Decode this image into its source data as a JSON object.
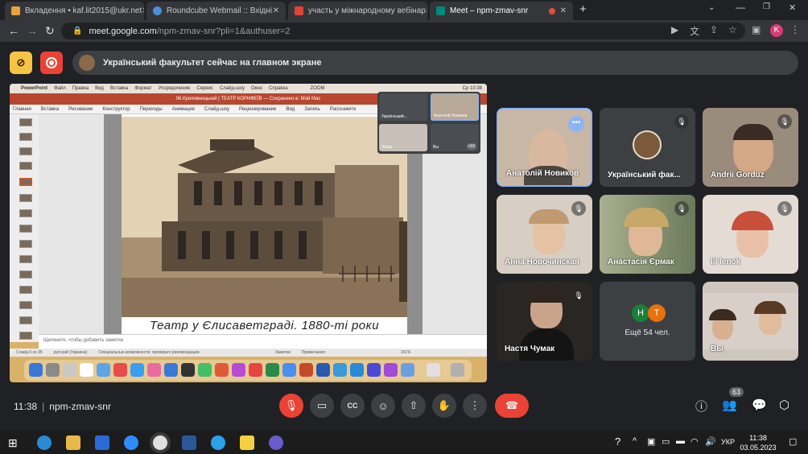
{
  "browser": {
    "tabs": [
      {
        "title": "Вкладення • kaf.lit2015@ukr.net",
        "color": "#e8a33d"
      },
      {
        "title": "Roundcube Webmail :: Вхідні",
        "color": "#4a90d9"
      },
      {
        "title": "участь у міжнародному вебінар",
        "color": "#e34234"
      },
      {
        "title": "Meet – npm-zmav-snr",
        "color": "#00897b"
      }
    ],
    "url_host": "meet.google.com",
    "url_path": "/npm-zmav-snr?pli=1&authuser=2",
    "profile_initial": "K"
  },
  "meet": {
    "presenter_banner": "Український факультет сейчас на главном экране",
    "time": "11:38",
    "meeting_code": "npm-zmav-snr",
    "participants_count": "63"
  },
  "shared_screen": {
    "mac_menu": [
      "PowerPoint",
      "Файл",
      "Правка",
      "Вид",
      "Вставка",
      "Формат",
      "Упорядочение",
      "Сервис",
      "Слайд-шоу",
      "Окно",
      "Справка"
    ],
    "zoom_label": "ZOOM",
    "clock": "Ср 10:38",
    "doc_title": "06.Кропивницький | ТЕАТР КОРИФЕЇВ — Сохранено в: Мой Mac",
    "ribbon_tabs": [
      "Главная",
      "Вставка",
      "Рисование",
      "Конструктор",
      "Переходы",
      "Анимация",
      "Слайд-шоу",
      "Рецензирование",
      "Вид",
      "Запись",
      "Расскажите"
    ],
    "slide_caption": "Театр у Єлисаветграді. 1880-ті роки",
    "notes_placeholder": "Щелкните, чтобы добавить заметки",
    "status_left": "Слайд 6 из 35",
    "status_lang": "русский (Украина)",
    "status_access": "Специальные возможности: проверьте рекомендации",
    "status_notes": "Заметки",
    "status_comments": "Примечания",
    "status_zoom": "151%",
    "mini_tiles": [
      {
        "label": "Український..."
      },
      {
        "label": "Анатолій Новиков"
      },
      {
        "label": "Vitaliy"
      },
      {
        "label": "Вы"
      }
    ],
    "mini_more": "+59"
  },
  "tiles": [
    {
      "name": "Анатолій Новиков",
      "bg": "#c9b7a5",
      "face": "#d9b8a0"
    },
    {
      "name": "Український фак...",
      "bg": "#3c4043",
      "face": "#7a5a3a"
    },
    {
      "name": "Andrii Gorduz",
      "bg": "#9a8c7c",
      "face": "#d4a886"
    },
    {
      "name": "Анна Новочинская",
      "bg": "#d8cfc4",
      "face": "#e6c2a4"
    },
    {
      "name": "Анастасія Єрмак",
      "bg": "#8a9a7a",
      "face": "#e0b898"
    },
    {
      "name": "lil lenok",
      "bg": "#e4dcd4",
      "face": "#e8c0a8"
    },
    {
      "name": "Настя Чумак",
      "bg": "#2a2624",
      "face": "#caa48a"
    },
    {
      "name": "Ещё 54 чел.",
      "bg": "#3c4043",
      "face": ""
    },
    {
      "name": "Вы",
      "bg": "#cfc6bd",
      "face": "#d8b090"
    }
  ],
  "more_initials": [
    "Н",
    "Т"
  ],
  "taskbar": {
    "time": "11:38",
    "date": "03.05.2023",
    "lang": "УКР"
  }
}
